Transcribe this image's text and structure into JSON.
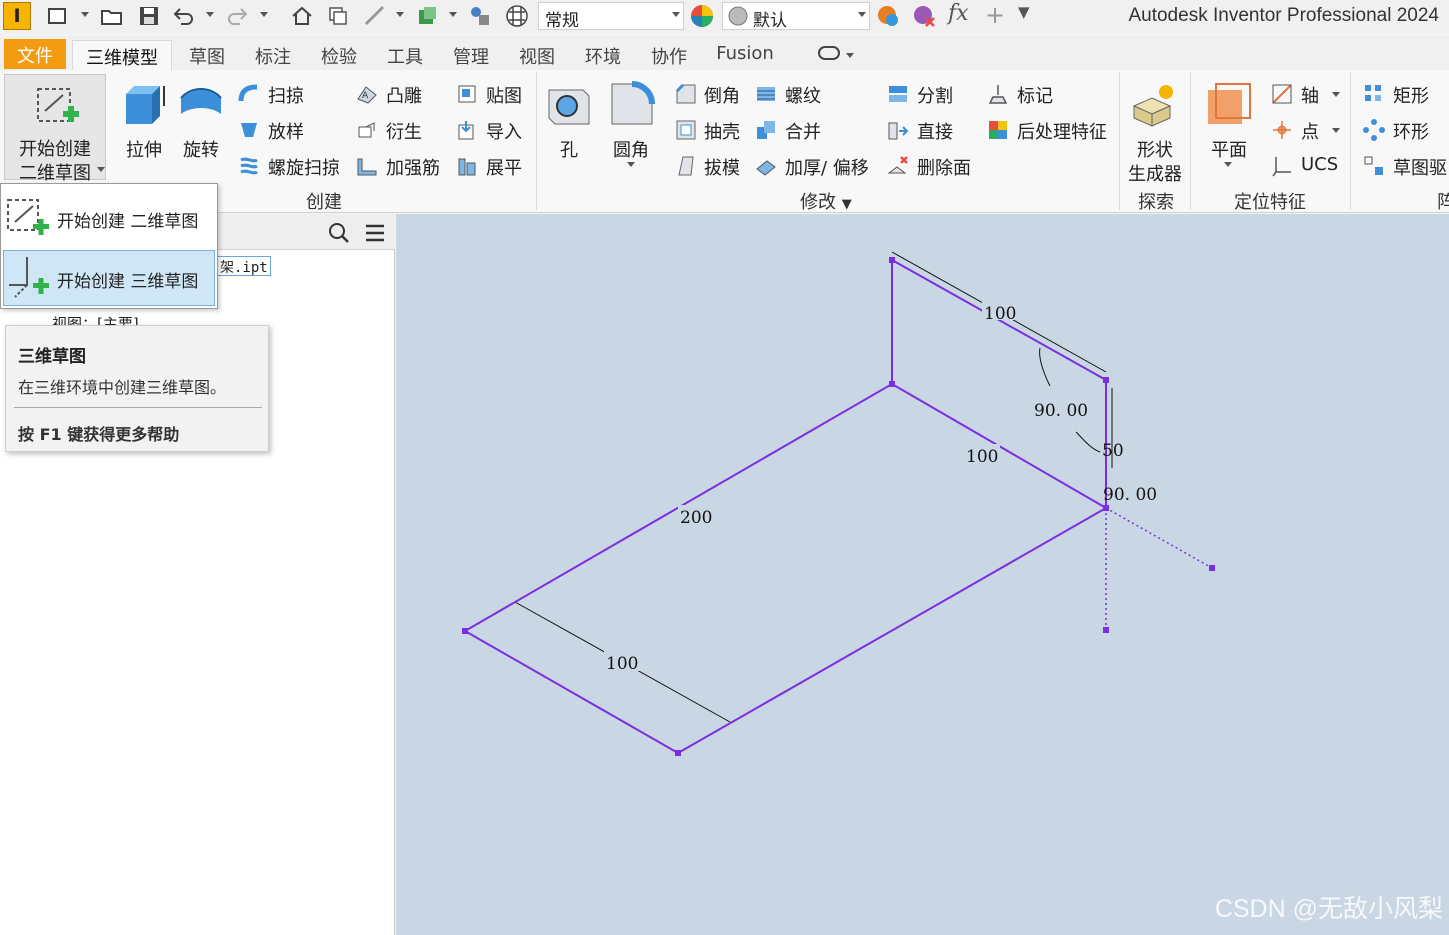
{
  "app": {
    "title": "Autodesk Inventor Professional 2024",
    "logo_letter": "I"
  },
  "qat": {
    "style_combo": "常规",
    "material_combo": "默认"
  },
  "tabs": [
    {
      "label": "三维模型"
    },
    {
      "label": "草图"
    },
    {
      "label": "标注"
    },
    {
      "label": "检验"
    },
    {
      "label": "工具"
    },
    {
      "label": "管理"
    },
    {
      "label": "视图"
    },
    {
      "label": "环境"
    },
    {
      "label": "协作"
    },
    {
      "label": "Fusion"
    }
  ],
  "file_tab": "文件",
  "ribbon": {
    "sketch_btn": [
      "开始创建",
      "二维草图"
    ],
    "extrude": "拉伸",
    "revolve": "旋转",
    "sweep": "扫掠",
    "loft": "放样",
    "coil": "螺旋扫掠",
    "emboss": "凸雕",
    "derive": "衍生",
    "rib": "加强筋",
    "decal": "贴图",
    "import": "导入",
    "unfold": "展平",
    "create_group": "创建",
    "hole": "孔",
    "fillet": "圆角",
    "chamfer": "倒角",
    "shell": "抽壳",
    "draft": "拔模",
    "thread": "螺纹",
    "combine": "合并",
    "thicken": "加厚/ 偏移",
    "split": "分割",
    "direct": "直接",
    "delete_face": "删除面",
    "mark": "标记",
    "postprocess": "后处理特征",
    "modify_group": "修改",
    "shape_gen": [
      "形状",
      "生成器"
    ],
    "explore_group": "探索",
    "plane": "平面",
    "axis": "轴",
    "point": "点",
    "ucs": "UCS",
    "work_group": "定位特征",
    "rect": "矩形",
    "circ": "环形",
    "sketch_drive": "草图驱",
    "pattern_group": "阵"
  },
  "browser": {
    "file_name": "架.ipt",
    "view_item": "视图：[主要]"
  },
  "dropdown": {
    "item1": "开始创建 二维草图",
    "item2": "开始创建 三维草图"
  },
  "tooltip": {
    "title": "三维草图",
    "desc": "在三维环境中创建三维草图。",
    "help": "按 F1 键获得更多帮助"
  },
  "dims": {
    "d1": "100",
    "d2": "90. 00",
    "d3": "50",
    "d4": "90. 00",
    "d5": "100",
    "d6": "200",
    "d7": "100"
  },
  "watermark": "CSDN @无敌小风梨",
  "colors": {
    "accent": "#f39c12",
    "sketch": "#7b2ee0",
    "viewport": "#c9d6e4"
  }
}
